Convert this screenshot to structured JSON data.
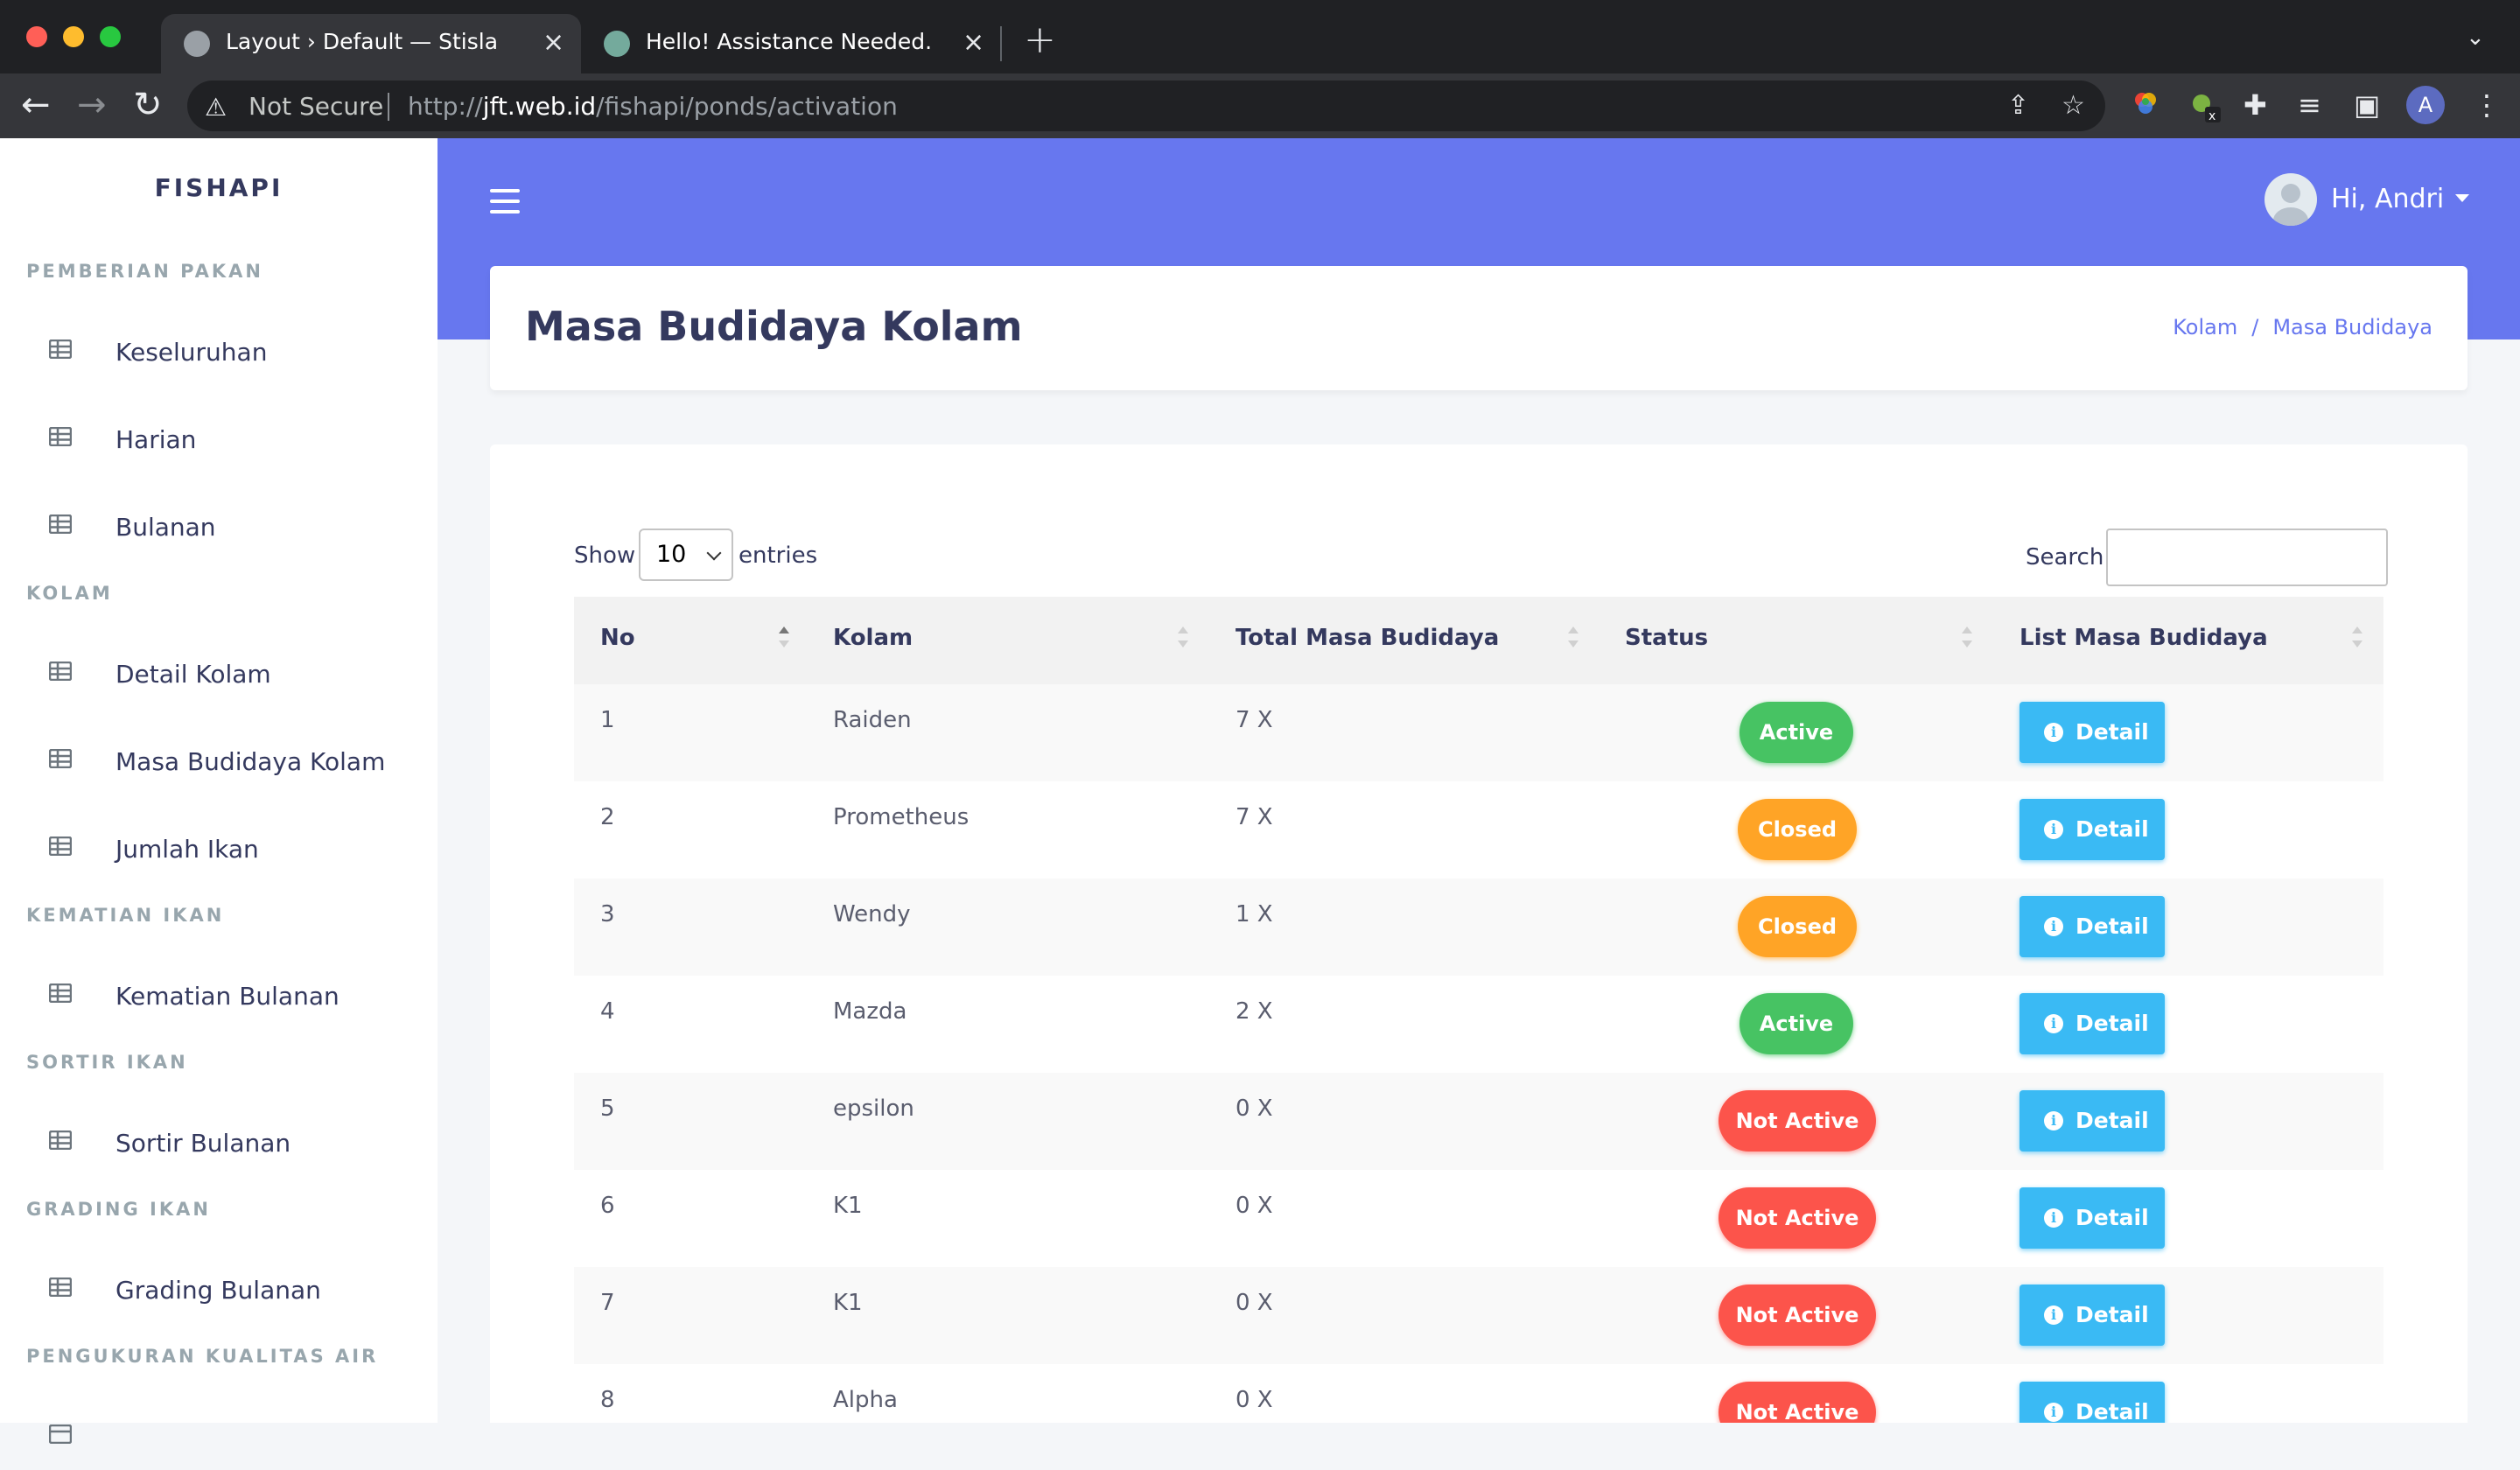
{
  "browser": {
    "tabs": [
      {
        "title": "Layout › Default — Stisla",
        "active": true
      },
      {
        "title": "Hello! Assistance Needed.",
        "active": false
      }
    ],
    "address": {
      "security_label": "Not Secure",
      "url_scheme": "http://",
      "url_host": "jft.web.id",
      "url_path": "/fishapi/ponds/activation"
    },
    "profile_initial": "A"
  },
  "sidebar": {
    "brand": "FISHAPI",
    "sections": [
      {
        "header": "PEMBERIAN PAKAN",
        "items": [
          "Keseluruhan",
          "Harian",
          "Bulanan"
        ]
      },
      {
        "header": "KOLAM",
        "items": [
          "Detail Kolam",
          "Masa Budidaya Kolam",
          "Jumlah Ikan"
        ]
      },
      {
        "header": "KEMATIAN IKAN",
        "items": [
          "Kematian Bulanan"
        ]
      },
      {
        "header": "SORTIR IKAN",
        "items": [
          "Sortir Bulanan"
        ]
      },
      {
        "header": "GRADING IKAN",
        "items": [
          "Grading Bulanan"
        ]
      },
      {
        "header": "PENGUKURAN KUALITAS AIR",
        "items": []
      }
    ]
  },
  "navbar": {
    "greeting": "Hi, Andri"
  },
  "page": {
    "title": "Masa Budidaya Kolam",
    "breadcrumb": [
      "Kolam",
      "Masa Budidaya"
    ]
  },
  "table_controls": {
    "show_label": "Show",
    "entries_value": "10",
    "entries_label": "entries",
    "search_label": "Search:",
    "search_value": ""
  },
  "table": {
    "columns": [
      "No",
      "Kolam",
      "Total Masa Budidaya",
      "Status",
      "List Masa Budidaya"
    ],
    "detail_label": "Detail",
    "rows": [
      {
        "no": "1",
        "kolam": "Raiden",
        "total": "7 X",
        "status": "Active"
      },
      {
        "no": "2",
        "kolam": "Prometheus",
        "total": "7 X",
        "status": "Closed"
      },
      {
        "no": "3",
        "kolam": "Wendy",
        "total": "1 X",
        "status": "Closed"
      },
      {
        "no": "4",
        "kolam": "Mazda",
        "total": "2 X",
        "status": "Active"
      },
      {
        "no": "5",
        "kolam": "epsilon",
        "total": "0 X",
        "status": "Not Active"
      },
      {
        "no": "6",
        "kolam": "K1",
        "total": "0 X",
        "status": "Not Active"
      },
      {
        "no": "7",
        "kolam": "K1",
        "total": "0 X",
        "status": "Not Active"
      },
      {
        "no": "8",
        "kolam": "Alpha",
        "total": "0 X",
        "status": "Not Active"
      }
    ]
  },
  "colors": {
    "primary": "#6777ef",
    "active": "#47c363",
    "closed": "#ffa426",
    "not_active": "#fc544b",
    "info": "#3abaf4"
  }
}
